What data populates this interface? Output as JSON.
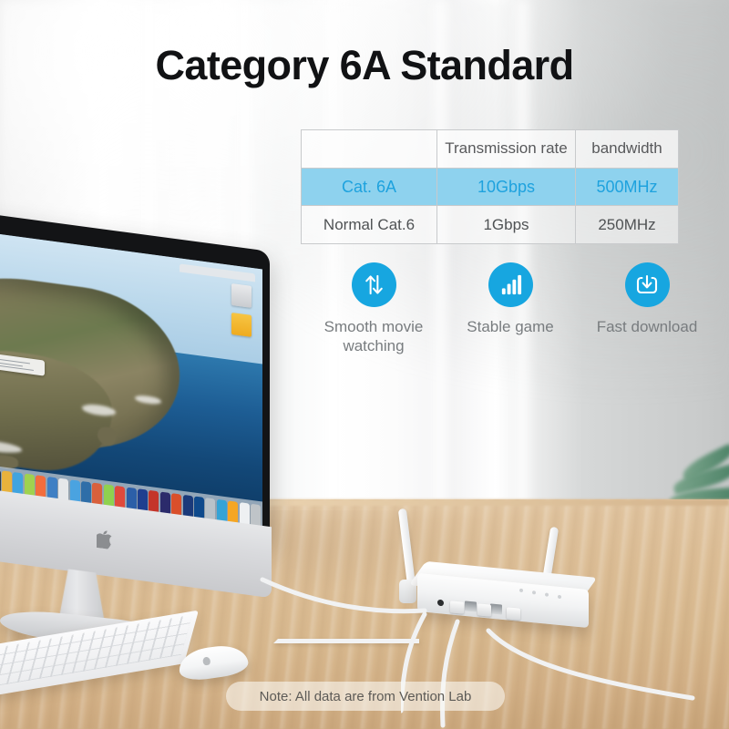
{
  "page": {
    "title": "Category 6A Standard",
    "note": "Note: All data are from Vention Lab"
  },
  "colors": {
    "accent_blue": "#17a6e0",
    "highlight_row_bg": "#8ed2ee",
    "highlight_row_text": "#1ea2de",
    "title_text": "#111214",
    "body_text": "#5e6164",
    "desk_wood": "#dcbe96"
  },
  "comparison_table": {
    "headers": [
      "",
      "Transmission rate",
      "bandwidth"
    ],
    "rows": [
      {
        "name": "Cat. 6A",
        "transmission_rate": "10Gbps",
        "bandwidth": "500MHz",
        "highlighted": true
      },
      {
        "name": "Normal Cat.6",
        "transmission_rate": "1Gbps",
        "bandwidth": "250MHz",
        "highlighted": false
      }
    ]
  },
  "features": [
    {
      "icon": "transfer-arrows-icon",
      "label": "Smooth movie watching"
    },
    {
      "icon": "signal-bars-icon",
      "label": "Stable game"
    },
    {
      "icon": "download-tray-icon",
      "label": "Fast download"
    }
  ],
  "scene": {
    "computer": "imac-all-in-one",
    "wallpaper": "catalina-island-seascape",
    "peripherals": [
      "magic-keyboard",
      "magic-mouse"
    ],
    "network_device": "wifi-router-dual-antenna",
    "decor": "potted-plant"
  }
}
